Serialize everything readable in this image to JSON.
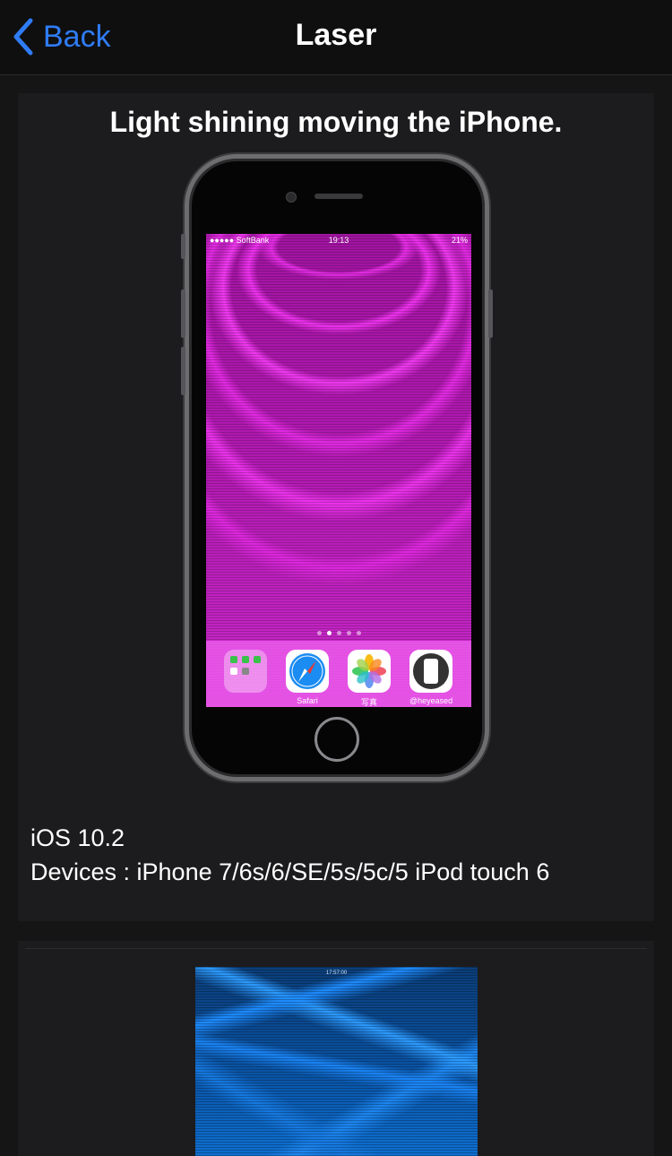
{
  "navbar": {
    "back_label": "Back",
    "title": "Laser"
  },
  "card1": {
    "title": "Light shining moving the iPhone.",
    "phone_screen": {
      "carrier": "●●●●● SoftBank",
      "time": "19:13",
      "battery": "21%",
      "page_dots": 5,
      "active_dot": 2,
      "dock_apps": [
        {
          "label": "",
          "icon": "folder-icon"
        },
        {
          "label": "Safari",
          "icon": "safari-icon"
        },
        {
          "label": "写真",
          "icon": "photos-icon"
        },
        {
          "label": "@heyeased",
          "icon": "heyeased-icon"
        }
      ]
    },
    "ios_version": "iOS 10.2",
    "devices": "Devices : iPhone 7/6s/6/SE/5s/5c/5 iPod touch 6"
  },
  "card2": {
    "image_time": "17:57:00"
  },
  "colors": {
    "accent": "#2f7cf6",
    "background": "#151516",
    "card": "#1c1c1e",
    "laser_magenta": "#ee33ee",
    "laser_blue": "#1e8cff"
  }
}
